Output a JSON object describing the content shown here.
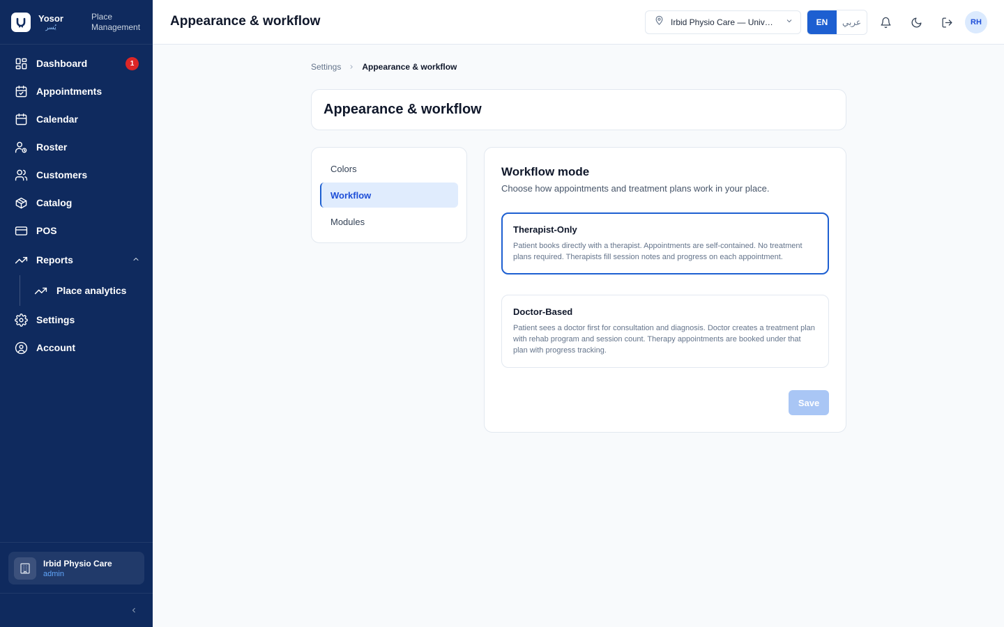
{
  "brand": {
    "name": "Yosor",
    "arabic": "يُسر",
    "subtitle": "Place Management"
  },
  "sidebar": {
    "items": [
      {
        "label": "Dashboard",
        "icon": "dashboard-icon",
        "badge": "1"
      },
      {
        "label": "Appointments",
        "icon": "calendar-check-icon"
      },
      {
        "label": "Calendar",
        "icon": "calendar-icon"
      },
      {
        "label": "Roster",
        "icon": "user-clock-icon"
      },
      {
        "label": "Customers",
        "icon": "users-icon"
      },
      {
        "label": "Catalog",
        "icon": "package-icon"
      },
      {
        "label": "POS",
        "icon": "credit-card-icon"
      },
      {
        "label": "Reports",
        "icon": "trending-up-icon",
        "expanded": true
      },
      {
        "label": "Place analytics",
        "icon": "trending-up-icon",
        "sub": true
      },
      {
        "label": "Settings",
        "icon": "gear-icon"
      },
      {
        "label": "Account",
        "icon": "user-circle-icon"
      }
    ],
    "place_card": {
      "name": "Irbid Physio Care",
      "role": "admin"
    }
  },
  "header": {
    "title": "Appearance & workflow",
    "place_selector": "Irbid Physio Care — University Street",
    "lang_en": "EN",
    "lang_ar": "عربي",
    "avatar_initials": "RH"
  },
  "breadcrumb": {
    "parent": "Settings",
    "current": "Appearance & workflow"
  },
  "page": {
    "title": "Appearance & workflow"
  },
  "tabs": [
    {
      "label": "Colors",
      "active": false
    },
    {
      "label": "Workflow",
      "active": true
    },
    {
      "label": "Modules",
      "active": false
    }
  ],
  "workflow": {
    "heading": "Workflow mode",
    "description": "Choose how appointments and treatment plans work in your place.",
    "options": [
      {
        "title": "Therapist-Only",
        "description": "Patient books directly with a therapist. Appointments are self-contained. No treatment plans required. Therapists fill session notes and progress on each appointment.",
        "selected": true
      },
      {
        "title": "Doctor-Based",
        "description": "Patient sees a doctor first for consultation and diagnosis. Doctor creates a treatment plan with rehab program and session count. Therapy appointments are booked under that plan with progress tracking.",
        "selected": false
      }
    ],
    "save_label": "Save"
  },
  "colors": {
    "sidebar_bg": "#0f2a5e",
    "accent": "#1d5fd1",
    "badge": "#dc2626"
  }
}
